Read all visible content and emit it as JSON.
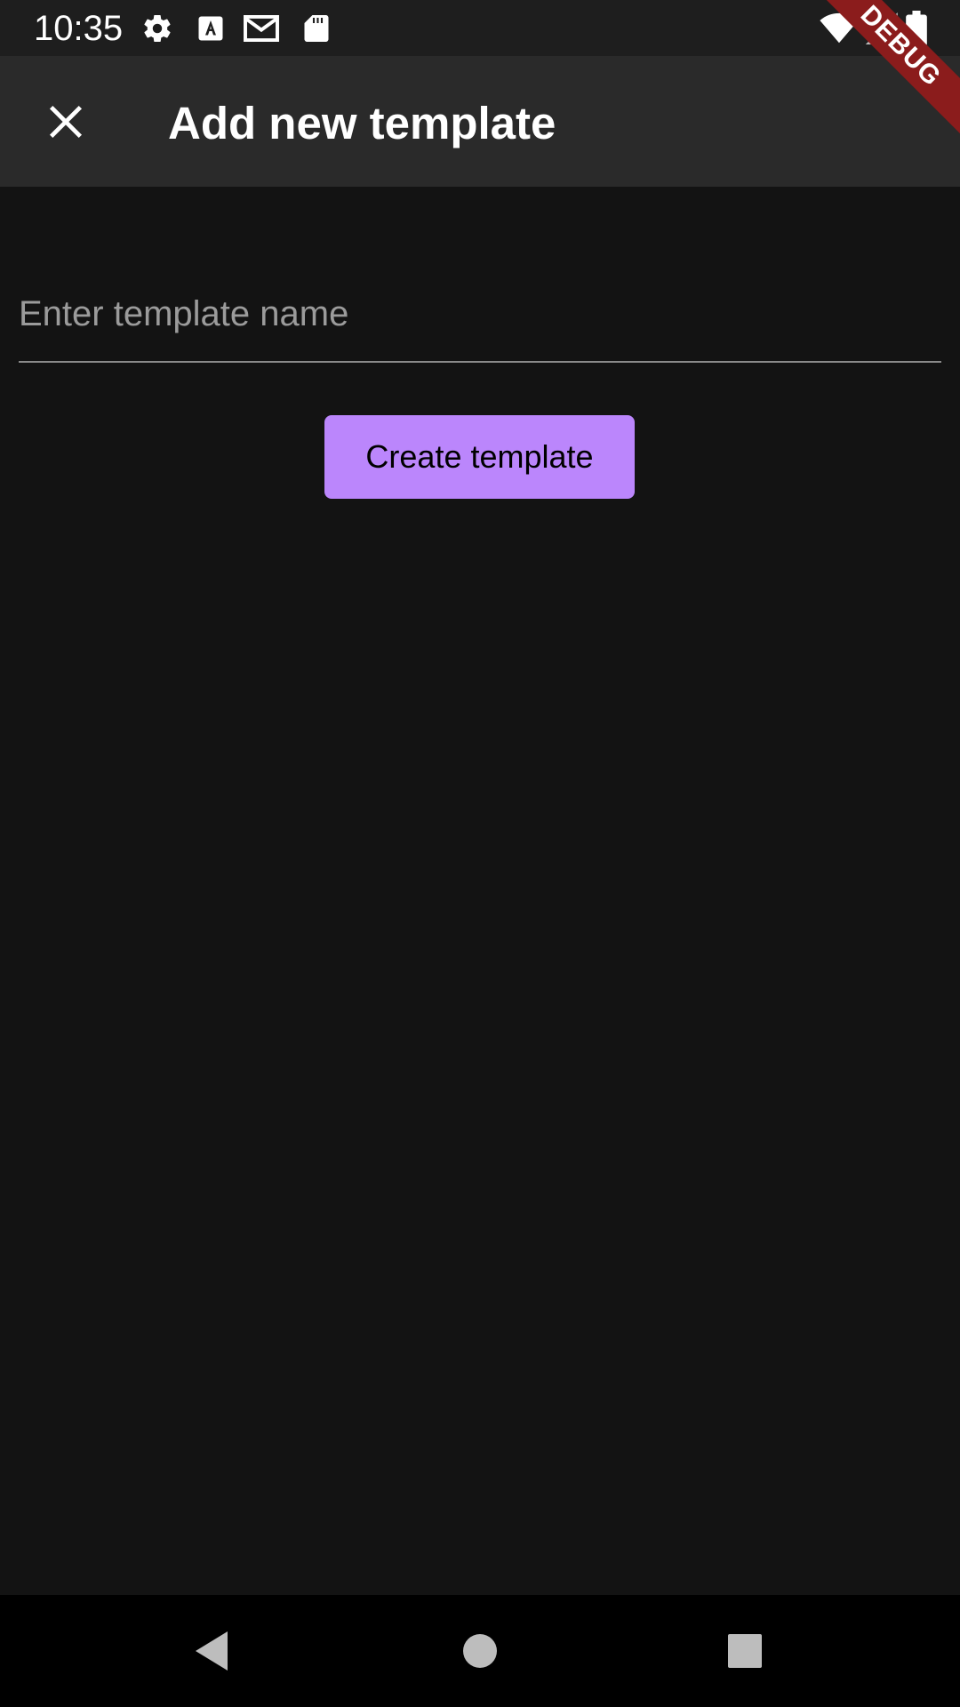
{
  "status_bar": {
    "time": "10:35",
    "icons_left": [
      "settings-icon",
      "text-a-icon",
      "gmail-icon",
      "sd-card-icon"
    ],
    "icons_right": [
      "wifi-icon",
      "signal-icon",
      "battery-icon"
    ]
  },
  "debug_banner": "DEBUG",
  "app_bar": {
    "title": "Add new template",
    "close_icon": "close-icon"
  },
  "form": {
    "template_name": {
      "value": "",
      "placeholder": "Enter template name"
    },
    "create_button_label": "Create template"
  },
  "nav_bar": {
    "buttons": [
      "back-icon",
      "home-icon",
      "recents-icon"
    ]
  },
  "colors": {
    "background": "#131313",
    "app_bar": "#2a2a2a",
    "status_bar": "#1e1e1e",
    "accent": "#bb86fc",
    "debug_banner": "#8b1c1c",
    "nav_bar": "#000000"
  }
}
